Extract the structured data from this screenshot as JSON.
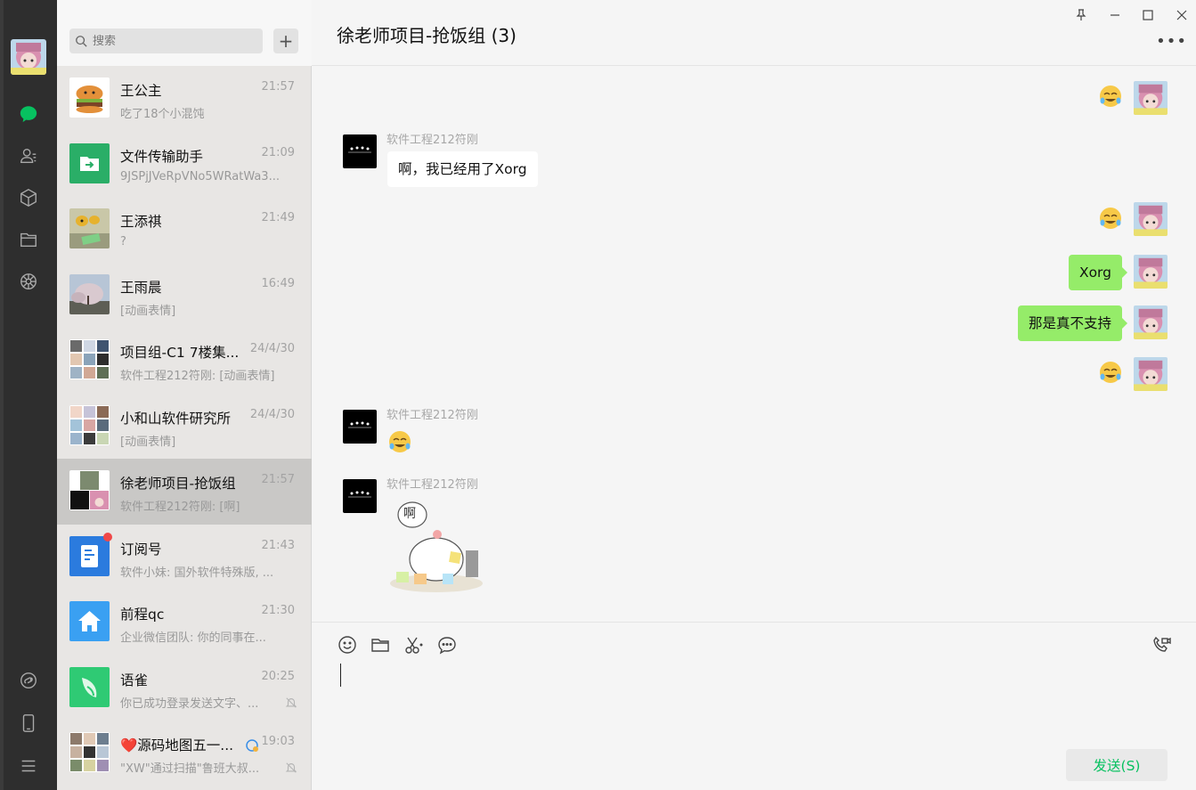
{
  "navbar": {
    "icons": [
      "chat-icon",
      "contacts-icon",
      "favorites-icon",
      "files-icon",
      "moments-icon",
      "mini-programs-icon",
      "phone-icon",
      "menu-icon"
    ]
  },
  "search": {
    "placeholder": "搜索",
    "add_label": "+"
  },
  "sessions": [
    {
      "name": "王公主",
      "time": "21:57",
      "preview": "吃了18个小混饨"
    },
    {
      "name": "文件传输助手",
      "time": "21:09",
      "preview": "9JSPjJVeRpVNo5WRatWa3..."
    },
    {
      "name": "王添祺",
      "time": "21:49",
      "preview": "?"
    },
    {
      "name": "王雨晨",
      "time": "16:49",
      "preview": "[动画表情]"
    },
    {
      "name": "项目组-C1 7楼集...",
      "time": "24/4/30",
      "preview": "软件工程212符刚: [动画表情]"
    },
    {
      "name": "小和山软件研究所",
      "time": "24/4/30",
      "preview": "[动画表情]"
    },
    {
      "name": "徐老师项目-抢饭组",
      "time": "21:57",
      "preview": "软件工程212符刚: [啊]"
    },
    {
      "name": "订阅号",
      "time": "21:43",
      "preview": "软件小妹: 国外软件特殊版, ..."
    },
    {
      "name": "前程qc",
      "time": "21:30",
      "preview": "企业微信团队: 你的同事在..."
    },
    {
      "name": "语雀",
      "time": "20:25",
      "preview": "你已成功登录发送文字、..."
    },
    {
      "name": "❤️源码地图五一...",
      "time": "19:03",
      "preview": "\"XW\"通过扫描\"鲁班大叔..."
    }
  ],
  "chat": {
    "title": "徐老师项目-抢饭组 (3)",
    "more": "•••",
    "messages": [
      {
        "side": "right",
        "kind": "emoji"
      },
      {
        "side": "left",
        "sender": "软件工程212符刚",
        "kind": "text",
        "text": "啊，我已经用了Xorg"
      },
      {
        "side": "right",
        "kind": "emoji"
      },
      {
        "side": "right",
        "kind": "text",
        "text": "Xorg"
      },
      {
        "side": "right",
        "kind": "text",
        "text": "那是真不支持"
      },
      {
        "side": "right",
        "kind": "emoji"
      },
      {
        "side": "left",
        "sender": "软件工程212符刚",
        "kind": "emoji"
      },
      {
        "side": "left",
        "sender": "软件工程212符刚",
        "kind": "sticker",
        "sticker_text": "啊"
      }
    ]
  },
  "composer": {
    "tools": [
      "emoji-icon",
      "folder-icon",
      "scissors-icon",
      "chat-bubble-icon"
    ],
    "send_label": "发送(S)"
  },
  "colors": {
    "brand": "#07c160",
    "bubble_self": "#95ec69",
    "sidebar": "#2e2e2e"
  }
}
